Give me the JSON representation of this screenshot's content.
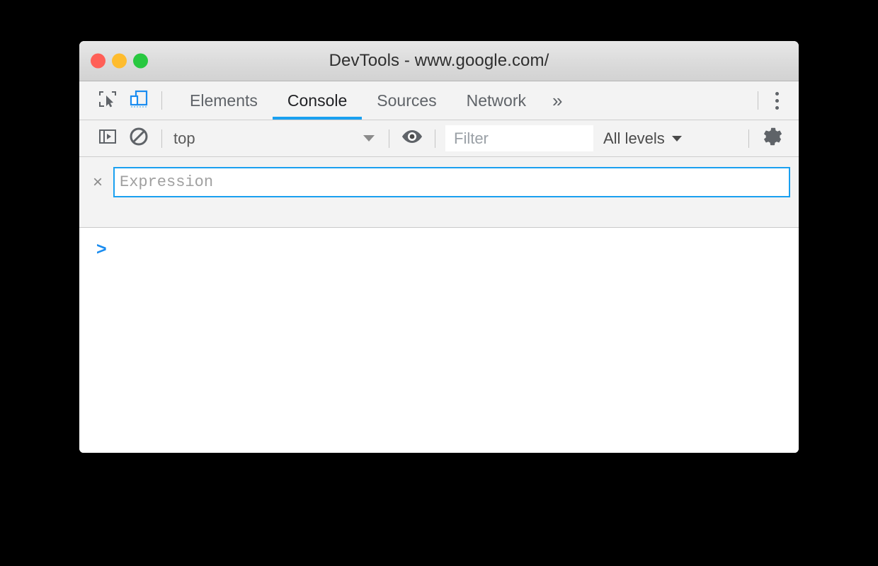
{
  "window": {
    "title": "DevTools - www.google.com/",
    "traffic_lights": [
      {
        "name": "close",
        "color": "#ff5f57"
      },
      {
        "name": "minimize",
        "color": "#febc2e"
      },
      {
        "name": "zoom",
        "color": "#28c840"
      }
    ]
  },
  "tabbar": {
    "inspect_icon": "inspect-element-icon",
    "device_icon": "device-toolbar-icon",
    "tabs": [
      {
        "label": "Elements",
        "active": false
      },
      {
        "label": "Console",
        "active": true
      },
      {
        "label": "Sources",
        "active": false
      },
      {
        "label": "Network",
        "active": false
      }
    ],
    "overflow_label": "»",
    "menu_icon": "more-vertical-icon",
    "active_underline_color": "#1aa0f0"
  },
  "console_toolbar": {
    "sidebar_toggle_icon": "console-sidebar-icon",
    "clear_icon": "clear-console-icon",
    "context": {
      "value": "top",
      "caret": "▼"
    },
    "eye_icon": "create-live-expression-icon",
    "filter": {
      "value": "",
      "placeholder": "Filter"
    },
    "levels": {
      "label": "All levels",
      "caret": "▼"
    },
    "settings_icon": "gear-icon"
  },
  "live_expression": {
    "close_label": "×",
    "input": {
      "value": "",
      "placeholder": "Expression"
    },
    "focus_border_color": "#1aa0f0"
  },
  "console_output": {
    "prompt": ">",
    "prompt_color": "#1a8cf0",
    "messages": []
  }
}
